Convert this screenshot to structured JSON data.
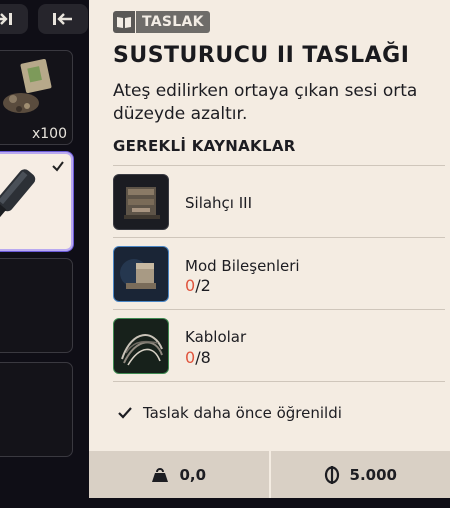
{
  "left_panel": {
    "top_buttons": [
      "arrow-right-icon",
      "collapse-left-icon"
    ],
    "slots": [
      {
        "item": "junk-pile",
        "quantity": "x100",
        "selected": false
      },
      {
        "item": "silencer",
        "selected": true,
        "checked": true
      },
      {
        "item": "empty"
      },
      {
        "item": "empty"
      }
    ]
  },
  "blueprint": {
    "badge": "TASLAK",
    "badge_icon": "book-icon",
    "title": "SUSTURUCU II TASLAĞI",
    "description": "Ateş edilirken ortaya çıkan sesi orta düzeyde azaltır.",
    "section_title": "GEREKLİ KAYNAKLAR",
    "resources": [
      {
        "name": "Silahçı III",
        "icon": "workbench-icon",
        "have": "",
        "need": ""
      },
      {
        "name": "Mod Bileşenleri",
        "icon": "mod-components-icon",
        "have": "0",
        "need": "/2"
      },
      {
        "name": "Kablolar",
        "icon": "cables-icon",
        "have": "0",
        "need": "/8"
      }
    ],
    "learned_text": "Taslak daha önce öğrenildi",
    "footer": {
      "weight": "0,0",
      "price": "5.000"
    }
  },
  "colors": {
    "panel_bg": "#f4ece2",
    "footer_bg": "#d9d0c5",
    "missing_count": "#e0553e",
    "selected_border": "#b9a9f0"
  }
}
